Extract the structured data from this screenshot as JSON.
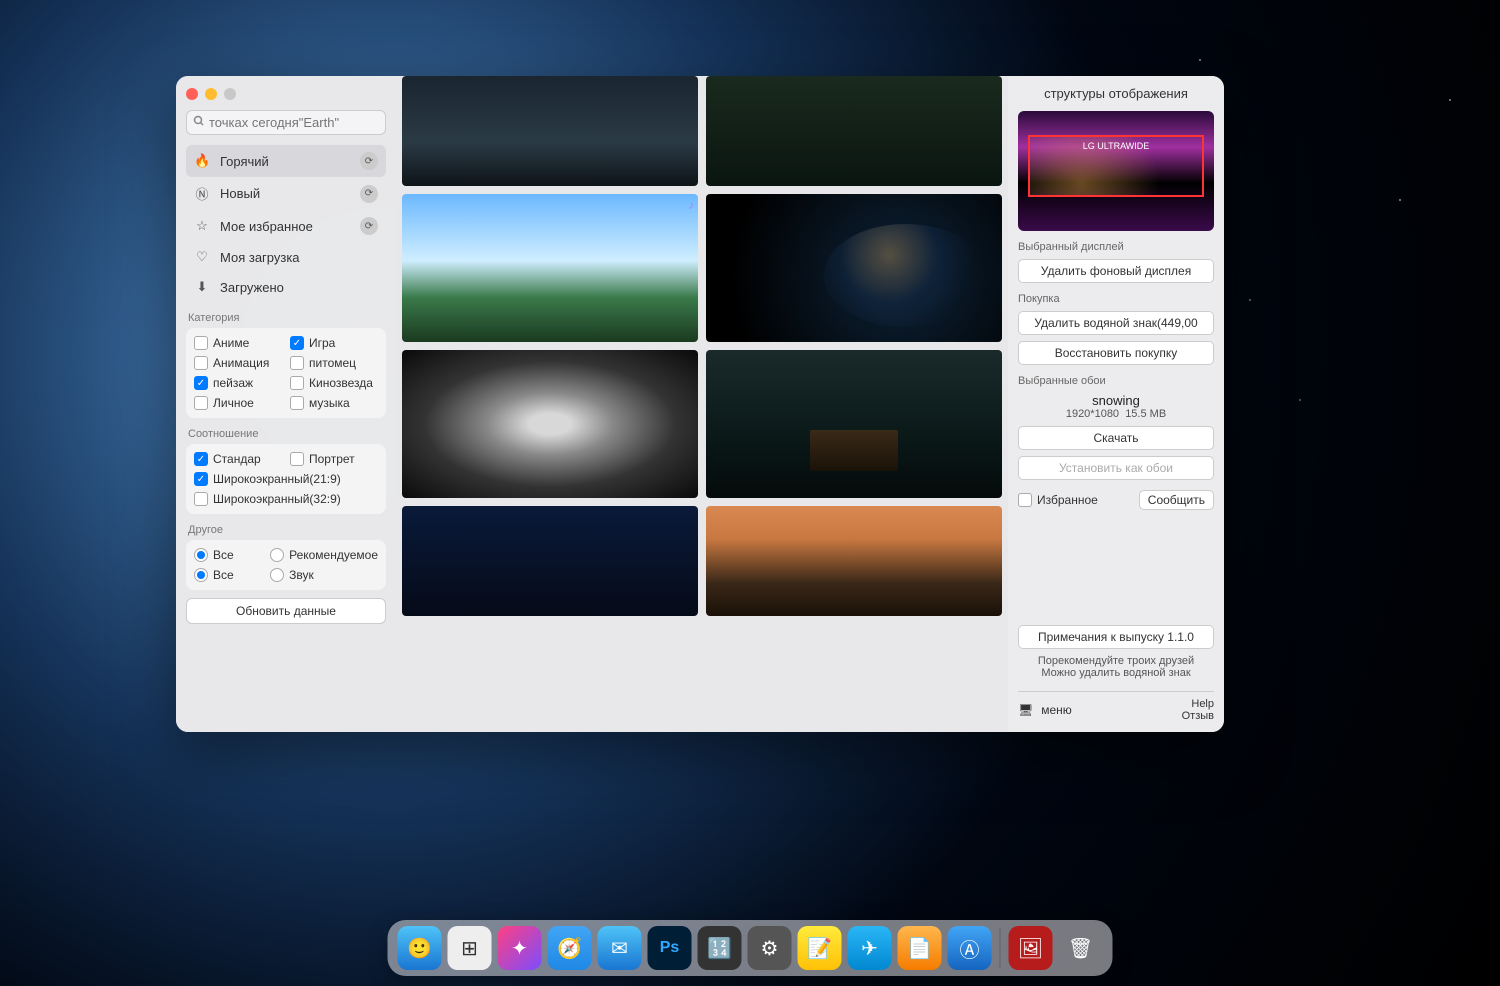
{
  "search": {
    "placeholder": "точках сегодня\"Earth\""
  },
  "nav": {
    "hot": "Горячий",
    "new": "Новый",
    "favorites": "Мое избранное",
    "downloads": "Моя загрузка",
    "loaded": "Загружено"
  },
  "category": {
    "label": "Категория",
    "items": [
      {
        "label": "Аниме",
        "checked": false
      },
      {
        "label": "Игра",
        "checked": true
      },
      {
        "label": "Анимация",
        "checked": false
      },
      {
        "label": "питомец",
        "checked": false
      },
      {
        "label": "пейзаж",
        "checked": true
      },
      {
        "label": "Кинозвезда",
        "checked": false
      },
      {
        "label": "Личное",
        "checked": false
      },
      {
        "label": "музыка",
        "checked": false
      }
    ]
  },
  "ratio": {
    "label": "Соотношение",
    "standard": "Стандар",
    "portrait": "Портрет",
    "wide219": "Широкоэкранный(21:9)",
    "wide329": "Широкоэкранный(32:9)"
  },
  "other": {
    "label": "Другое",
    "all1": "Все",
    "recommended": "Рекомендуемое",
    "all2": "Все",
    "sound": "Звук"
  },
  "refresh_data": "Обновить данные",
  "right": {
    "title": "структуры отображения",
    "display_label": "LG ULTRAWIDE",
    "selected_display": "Выбранный дисплей",
    "delete_bg": "Удалить фоновый дисплея",
    "purchase": "Покупка",
    "remove_watermark": "Удалить водяной знак(449,00",
    "restore_purchase": "Восстановить покупку",
    "selected_wall": "Выбранные обои",
    "wall_name": "snowing",
    "wall_res": "1920*1080",
    "wall_size": "15.5 MB",
    "download": "Скачать",
    "set_wall": "Установить как обои",
    "favorite": "Избранное",
    "report": "Сообщить",
    "release_notes": "Примечания к выпуску 1.1.0",
    "recommend1": "Порекомендуйте троих друзей",
    "recommend2": "Можно удалить водяной знак",
    "menu": "меню",
    "help": "Help",
    "feedback": "Отзыв"
  },
  "dock": {
    "apps": [
      "Finder",
      "Launchpad",
      "Arc",
      "Safari",
      "Mail",
      "Photoshop",
      "Calculator",
      "Settings",
      "Notes",
      "Telegram",
      "Pages",
      "AppStore"
    ],
    "right": [
      "Wallpaper",
      "Trash"
    ]
  }
}
